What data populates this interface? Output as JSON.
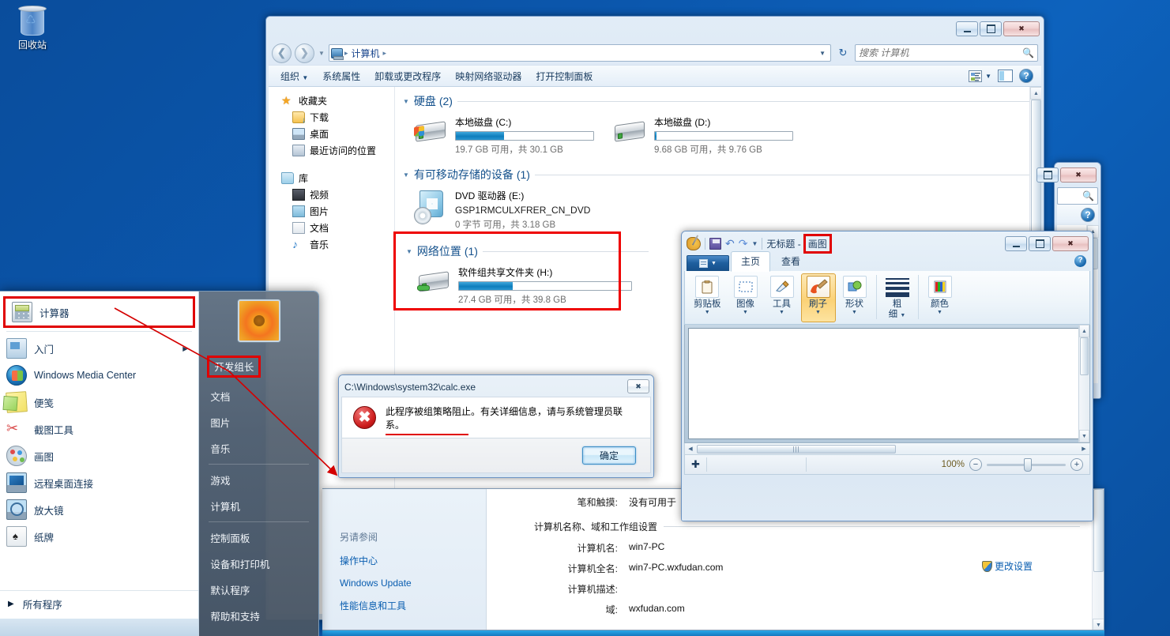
{
  "desktop": {
    "recycle_bin_label": "回收站",
    "wallpaper_color": "#0b57ad"
  },
  "explorer": {
    "nav": {
      "back_icon": "back-arrow-icon",
      "forward_icon": "forward-arrow-icon",
      "recent_dropdown_icon": "chevron-down-icon",
      "refresh_icon": "refresh-icon"
    },
    "breadcrumb": {
      "computer_icon": "computer-icon",
      "items": [
        "计算机"
      ],
      "sep": "▶"
    },
    "search": {
      "placeholder": "搜索 计算机",
      "icon": "search-icon"
    },
    "toolbar": {
      "organize": "组织",
      "system_properties": "系统属性",
      "uninstall": "卸载或更改程序",
      "map_drive": "映射网络驱动器",
      "open_control_panel": "打开控制面板",
      "view_icon": "view-layout-icon",
      "preview_pane_icon": "preview-pane-icon",
      "help_icon": "help-icon"
    },
    "navpane": {
      "favorites": "收藏夹",
      "favorites_items": [
        "下载",
        "桌面",
        "最近访问的位置"
      ],
      "libraries": "库",
      "libraries_items": [
        "视频",
        "图片",
        "文档",
        "音乐"
      ]
    },
    "groups": [
      {
        "title": "硬盘",
        "count": "(2)",
        "drives": [
          {
            "name": "本地磁盘 (C:)",
            "free": "19.7 GB 可用，共 30.1 GB",
            "used_pct": 35,
            "bar_color": "#0e7dbc"
          },
          {
            "name": "本地磁盘 (D:)",
            "free": "9.68 GB 可用，共 9.76 GB",
            "used_pct": 1,
            "bar_color": "#0e7dbc"
          }
        ]
      },
      {
        "title": "有可移动存储的设备",
        "count": "(1)",
        "drives": [
          {
            "name": "DVD 驱动器 (E:)",
            "volume": "GSP1RMCULXFRER_CN_DVD",
            "free": "0 字节 可用，共 3.18 GB",
            "used_pct": 0
          }
        ]
      },
      {
        "title": "网络位置",
        "count": "(1)",
        "highlight_color": "#ee0000",
        "drives": [
          {
            "name": "软件组共享文件夹 (H:)",
            "free": "27.4 GB 可用，共 39.8 GB",
            "used_pct": 31,
            "bar_color": "#0e7dbc"
          }
        ]
      }
    ]
  },
  "system_properties": {
    "see_also_title": "另请参阅",
    "see_also_links": [
      "操作中心",
      "Windows Update",
      "性能信息和工具"
    ],
    "pen_touch_label": "笔和触摸:",
    "pen_touch_value": "没有可用于",
    "section_title": "计算机名称、域和工作组设置",
    "rows": [
      {
        "label": "计算机名:",
        "value": "win7-PC"
      },
      {
        "label": "计算机全名:",
        "value": "win7-PC.wxfudan.com"
      },
      {
        "label": "计算机描述:",
        "value": ""
      },
      {
        "label": "域:",
        "value": "wxfudan.com"
      }
    ],
    "change_settings": "更改设置",
    "shield_icon": "uac-shield-icon"
  },
  "paint": {
    "title_prefix": "无标题 - ",
    "title_app": "画图",
    "highlight_color": "#e00000",
    "quick_access": {
      "palette_icon": "paint-palette-icon",
      "save_icon": "save-icon",
      "undo_icon": "undo-icon",
      "redo_icon": "redo-icon",
      "customize_icon": "chevron-down-icon"
    },
    "menu_button_label": "",
    "tabs": [
      {
        "label": "主页",
        "active": true
      },
      {
        "label": "查看",
        "active": false
      }
    ],
    "help_icon": "help-icon",
    "ribbon_groups": [
      {
        "label": "剪贴板",
        "icon": "clipboard-icon",
        "dropdown": true,
        "selected": false
      },
      {
        "label": "图像",
        "icon": "selection-icon",
        "dropdown": true,
        "selected": false
      },
      {
        "label": "工具",
        "icon": "tools-icon",
        "dropdown": true,
        "selected": false
      },
      {
        "label": "刷子",
        "icon": "brush-icon",
        "dropdown": true,
        "selected": true
      },
      {
        "label": "形状",
        "icon": "shapes-icon",
        "dropdown": true,
        "selected": false
      },
      {
        "label": "粗\n细",
        "icon": "line-thickness-icon",
        "dropdown": true,
        "selected": false
      },
      {
        "label": "颜色",
        "icon": "color-palette-icon",
        "dropdown": true,
        "selected": false
      }
    ],
    "status": {
      "cursor_icon": "move-crosshair-icon",
      "zoom_pct": "100%",
      "zoom_out_icon": "minus-icon",
      "zoom_in_icon": "plus-icon"
    }
  },
  "error_dialog": {
    "title": "C:\\Windows\\system32\\calc.exe",
    "close_icon": "close-icon",
    "error_icon": "error-x-icon",
    "message": "此程序被组策略阻止。有关详细信息，请与系统管理员联系。",
    "underline_color": "#e00000",
    "ok_button": "确定"
  },
  "start_menu": {
    "left_items": [
      {
        "label": "计算器",
        "icon": "calculator-icon",
        "highlighted": true,
        "arrow": false
      },
      {
        "label": "入门",
        "icon": "getting-started-icon",
        "highlighted": false,
        "arrow": true
      },
      {
        "label": "Windows Media Center",
        "icon": "media-center-icon",
        "highlighted": false,
        "arrow": false
      },
      {
        "label": "便笺",
        "icon": "sticky-notes-icon",
        "highlighted": false,
        "arrow": false
      },
      {
        "label": "截图工具",
        "icon": "snipping-tool-icon",
        "highlighted": false,
        "arrow": false
      },
      {
        "label": "画图",
        "icon": "paint-icon",
        "highlighted": false,
        "arrow": false
      },
      {
        "label": "远程桌面连接",
        "icon": "remote-desktop-icon",
        "highlighted": false,
        "arrow": false
      },
      {
        "label": "放大镜",
        "icon": "magnifier-icon",
        "highlighted": false,
        "arrow": false
      },
      {
        "label": "纸牌",
        "icon": "solitaire-icon",
        "highlighted": false,
        "arrow": false
      }
    ],
    "all_programs": "所有程序",
    "all_programs_icon": "triangle-right-icon",
    "avatar_icon": "user-avatar-flower",
    "right_items": [
      {
        "label": "开发组长",
        "highlighted": true,
        "sep_after": false
      },
      {
        "label": "文档",
        "highlighted": false,
        "sep_after": false
      },
      {
        "label": "图片",
        "highlighted": false,
        "sep_after": false
      },
      {
        "label": "音乐",
        "highlighted": false,
        "sep_after": true
      },
      {
        "label": "游戏",
        "highlighted": false,
        "sep_after": false
      },
      {
        "label": "计算机",
        "highlighted": false,
        "sep_after": true
      },
      {
        "label": "控制面板",
        "highlighted": false,
        "sep_after": false
      },
      {
        "label": "设备和打印机",
        "highlighted": false,
        "sep_after": false
      },
      {
        "label": "默认程序",
        "highlighted": false,
        "sep_after": false
      },
      {
        "label": "帮助和支持",
        "highlighted": false,
        "sep_after": false
      }
    ],
    "highlight_color": "#e00000"
  },
  "annotation": {
    "arrow_color": "#d40000",
    "description": "red-arrow-from-developer-lead-to-calculator"
  }
}
